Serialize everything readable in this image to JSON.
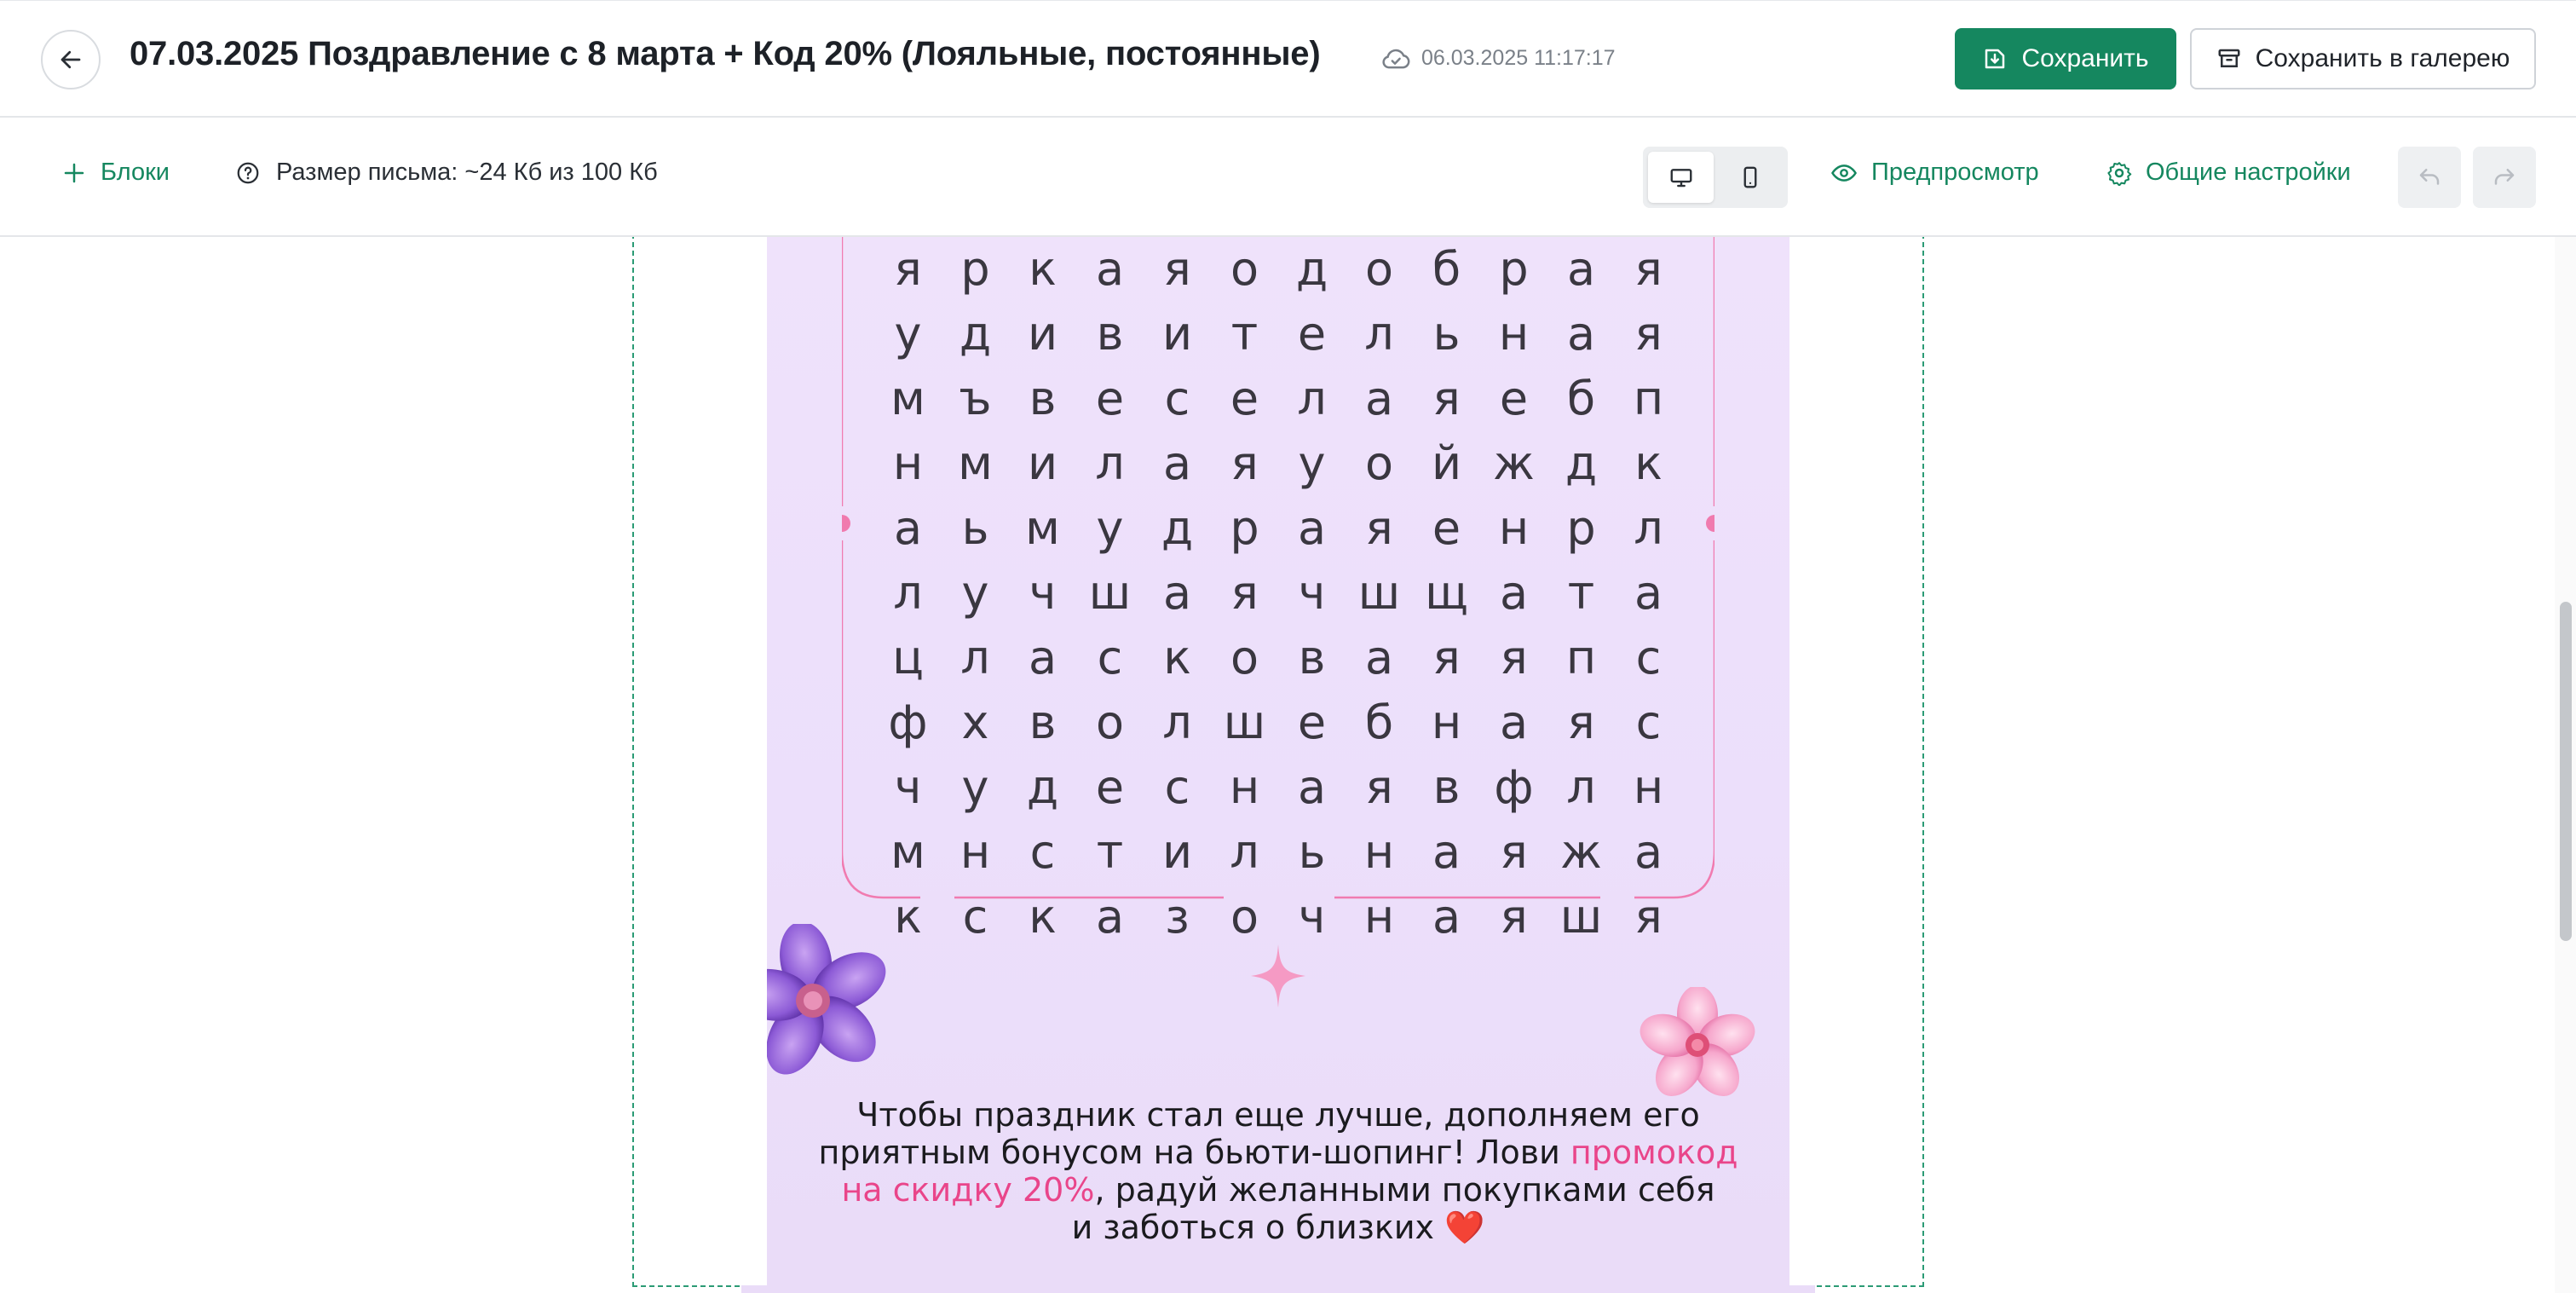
{
  "header": {
    "back_icon": "arrow-left-icon",
    "title": "07.03.2025 Поздравление с 8 марта + Код 20% (Лояльные, постоянные)",
    "saved_icon": "cloud-check-icon",
    "saved_at": "06.03.2025 11:17:17",
    "save_label": "Сохранить",
    "save_icon": "save-download-icon",
    "gallery_label": "Сохранить в галерею",
    "gallery_icon": "archive-box-icon"
  },
  "toolbar": {
    "blocks_label": "Блоки",
    "blocks_icon": "plus-icon",
    "size_icon": "question-circle-icon",
    "size_label": "Размер письма: ~24 Кб из 100 Кб",
    "device_desktop_icon": "desktop-icon",
    "device_mobile_icon": "mobile-icon",
    "active_device": "desktop",
    "preview_label": "Предпросмотр",
    "preview_icon": "eye-icon",
    "settings_label": "Общие настройки",
    "settings_icon": "gear-icon",
    "undo_icon": "undo-icon",
    "redo_icon": "redo-icon"
  },
  "colors": {
    "accent": "#15875f",
    "email_bg": "#ecdffb",
    "frame_pink": "#f17bb0",
    "promo_pink": "#e9458a",
    "letters": "#3a3740"
  },
  "email": {
    "word_grid": [
      [
        "я",
        "р",
        "к",
        "а",
        "я",
        "о",
        "д",
        "о",
        "б",
        "р",
        "а",
        "я"
      ],
      [
        "у",
        "д",
        "и",
        "в",
        "и",
        "т",
        "е",
        "л",
        "ь",
        "н",
        "а",
        "я"
      ],
      [
        "м",
        "ъ",
        "в",
        "е",
        "с",
        "е",
        "л",
        "а",
        "я",
        "е",
        "б",
        "п"
      ],
      [
        "н",
        "м",
        "и",
        "л",
        "а",
        "я",
        "у",
        "о",
        "й",
        "ж",
        "д",
        "к"
      ],
      [
        "а",
        "ь",
        "м",
        "у",
        "д",
        "р",
        "а",
        "я",
        "е",
        "н",
        "р",
        "л"
      ],
      [
        "л",
        "у",
        "ч",
        "ш",
        "а",
        "я",
        "ч",
        "ш",
        "щ",
        "а",
        "т",
        "а"
      ],
      [
        "ц",
        "л",
        "а",
        "с",
        "к",
        "о",
        "в",
        "а",
        "я",
        "я",
        "п",
        "с"
      ],
      [
        "ф",
        "х",
        "в",
        "о",
        "л",
        "ш",
        "е",
        "б",
        "н",
        "а",
        "я",
        "с"
      ],
      [
        "ч",
        "у",
        "д",
        "е",
        "с",
        "н",
        "а",
        "я",
        "в",
        "ф",
        "л",
        "н"
      ],
      [
        "м",
        "н",
        "с",
        "т",
        "и",
        "л",
        "ь",
        "н",
        "а",
        "я",
        "ж",
        "а"
      ],
      [
        "к",
        "с",
        "к",
        "а",
        "з",
        "о",
        "ч",
        "н",
        "а",
        "я",
        "ш",
        "я"
      ]
    ],
    "decor_icons": [
      "purple-flower-icon",
      "pink-flower-icon",
      "sparkle-star-icon"
    ],
    "message_line1": "Чтобы праздник стал еще лучше, дополняем его",
    "message_line2_a": "приятным бонусом на бьюти-шопинг! Лови ",
    "message_line2_promo": "промокод",
    "message_line3_promo": "на скидку 20%",
    "message_line3_b": ", радуй желанными покупками себя",
    "message_line4": "и заботься о близких ",
    "heart_emoji": "❤️"
  }
}
